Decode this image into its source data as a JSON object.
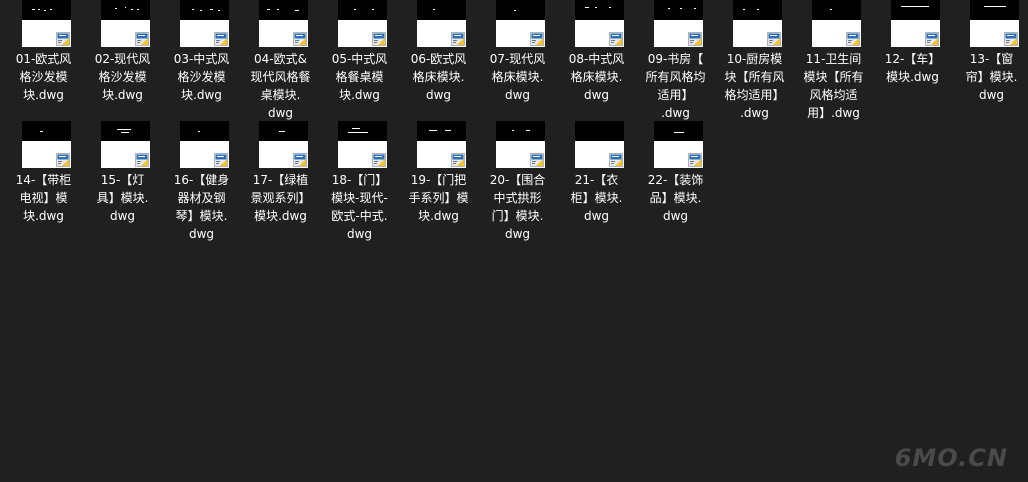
{
  "files": [
    {
      "label": "01-欧式风\n格沙发模\n块.dwg"
    },
    {
      "label": "02-现代风\n格沙发模\n块.dwg"
    },
    {
      "label": "03-中式风\n格沙发模\n块.dwg"
    },
    {
      "label": "04-欧式&\n现代风格餐\n桌模块.\ndwg"
    },
    {
      "label": "05-中式风\n格餐桌模\n块.dwg"
    },
    {
      "label": "06-欧式风\n格床模块.\ndwg"
    },
    {
      "label": "07-现代风\n格床模块.\ndwg"
    },
    {
      "label": "08-中式风\n格床模块.\ndwg"
    },
    {
      "label": "09-书房【\n所有风格均\n适用】\n.dwg"
    },
    {
      "label": "10-厨房模\n块【所有风\n格均适用】\n.dwg"
    },
    {
      "label": "11-卫生间\n模块【所有\n风格均适\n用】.dwg"
    },
    {
      "label": "12-【车】\n模块.dwg"
    },
    {
      "label": "13-【窗\n帘】模块.\ndwg"
    },
    {
      "label": "14-【带柜\n电视】模\n块.dwg"
    },
    {
      "label": "15-【灯\n具】模块.\ndwg"
    },
    {
      "label": "16-【健身\n器材及钢\n琴】模块.\ndwg"
    },
    {
      "label": "17-【绿植\n景观系列】\n模块.dwg"
    },
    {
      "label": "18-【门】\n模块-现代-\n欧式-中式.\ndwg"
    },
    {
      "label": "19-【门把\n手系列】模\n块.dwg"
    },
    {
      "label": "20-【围合\n中式拱形\n门】模块.\ndwg"
    },
    {
      "label": "21-【衣\n柜】模块.\ndwg"
    },
    {
      "label": "22-【装饰\n品】模块.\ndwg"
    }
  ],
  "watermark": "6MO.CN",
  "colors": {
    "background": "#202020",
    "text": "#ffffff",
    "badge_blue": "#2a6fb8",
    "badge_yellow": "#f2c230"
  },
  "icons": {
    "file_badge": "dwg-file-icon"
  }
}
